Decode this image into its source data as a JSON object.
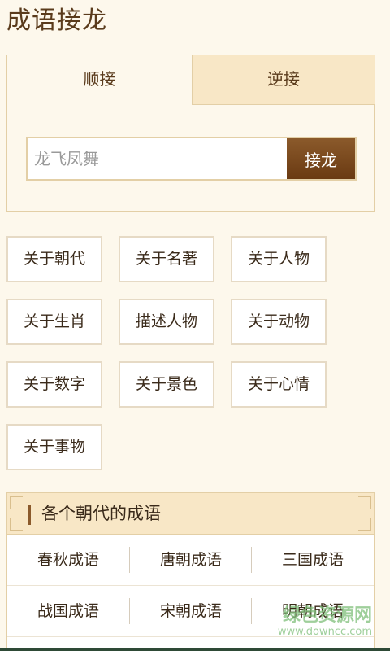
{
  "page": {
    "title": "成语接龙"
  },
  "tabs": [
    {
      "label": "顺接",
      "active": true
    },
    {
      "label": "逆接",
      "active": false
    }
  ],
  "search": {
    "placeholder": "龙飞凤舞",
    "value": "",
    "button_label": "接龙"
  },
  "categories": [
    "关于朝代",
    "关于名著",
    "关于人物",
    "关于生肖",
    "描述人物",
    "关于动物",
    "关于数字",
    "关于景色",
    "关于心情",
    "关于事物"
  ],
  "dynasty_section": {
    "title": "各个朝代的成语",
    "rows": [
      [
        "春秋成语",
        "唐朝成语",
        "三国成语"
      ],
      [
        "战国成语",
        "宋朝成语",
        "明朝成语"
      ]
    ]
  },
  "watermark": {
    "text": "绿色资源网",
    "url": "www.downcc.com"
  },
  "colors": {
    "background": "#fdf8ec",
    "accent_brown": "#8b5a2b",
    "tab_inactive": "#f8e7c6",
    "border": "#e3cfa6"
  }
}
